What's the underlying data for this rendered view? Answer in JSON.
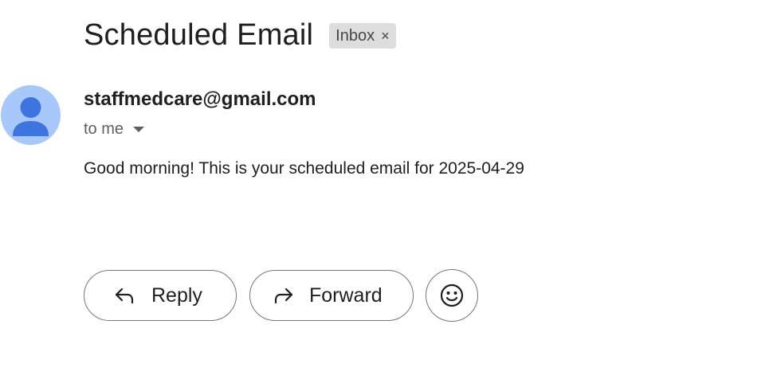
{
  "email": {
    "subject": "Scheduled Email",
    "label": {
      "text": "Inbox",
      "close_glyph": "×"
    },
    "sender": "staffmedcare@gmail.com",
    "recipient_text": "to me",
    "body": "Good morning! This is your scheduled email for 2025-04-29"
  },
  "actions": {
    "reply_label": "Reply",
    "forward_label": "Forward",
    "reply_icon": "reply-arrow-icon",
    "forward_icon": "forward-arrow-icon",
    "emoji_icon": "smiley-icon"
  },
  "colors": {
    "avatar_bg": "#a8c7fa",
    "avatar_fg": "#3d74e0",
    "chip_bg": "#dddddd",
    "text_primary": "#1f1f1f",
    "text_secondary": "#5e5e5e",
    "button_border": "#747775"
  }
}
